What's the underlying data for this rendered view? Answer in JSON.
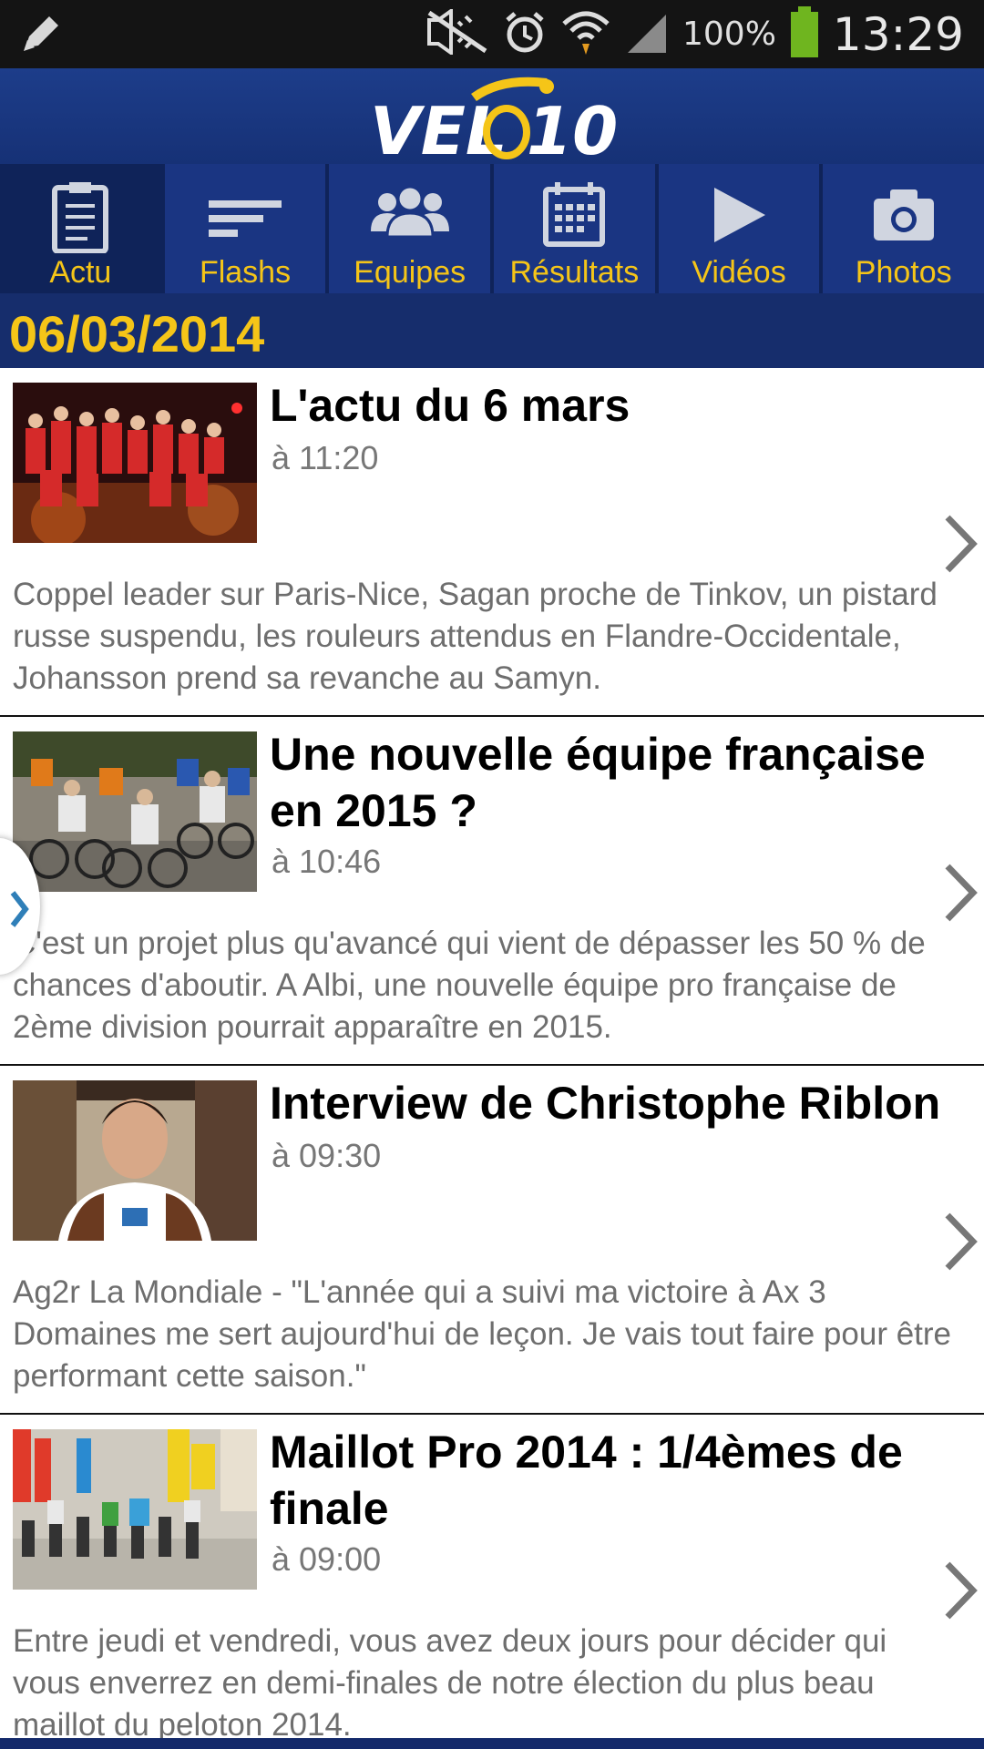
{
  "status_bar": {
    "battery_percent": "100%",
    "time": "13:29",
    "icons": [
      "edit-icon",
      "mute-icon",
      "alarm-icon",
      "wifi-icon",
      "signal-icon",
      "battery-icon"
    ]
  },
  "header": {
    "logo_text": "VELO101"
  },
  "nav": {
    "tabs": [
      {
        "label": "Actu",
        "icon": "clipboard-icon",
        "active": true
      },
      {
        "label": "Flashs",
        "icon": "lines-icon",
        "active": false
      },
      {
        "label": "Equipes",
        "icon": "team-icon",
        "active": false
      },
      {
        "label": "Résultats",
        "icon": "calendar-icon",
        "active": false
      },
      {
        "label": "Vidéos",
        "icon": "play-icon",
        "active": false
      },
      {
        "label": "Photos",
        "icon": "camera-icon",
        "active": false
      }
    ]
  },
  "date": "06/03/2014",
  "articles": [
    {
      "title": "L'actu du 6 mars",
      "time": "à 11:20",
      "description": "Coppel leader sur Paris-Nice, Sagan proche de Tinkov, un pistard russe suspendu, les rouleurs attendus en Flandre-Occidentale, Johansson prend sa revanche au Samyn."
    },
    {
      "title": "Une nouvelle équipe française en 2015 ?",
      "time": "à 10:46",
      "description": "C'est un projet plus qu'avancé qui vient de dépasser les 50 % de chances d'aboutir. A Albi, une nouvelle équipe pro française de 2ème division pourrait apparaître en 2015."
    },
    {
      "title": "Interview de Christophe Riblon",
      "time": "à 09:30",
      "description": "Ag2r La Mondiale - \"L'année qui a suivi ma victoire à Ax 3 Domaines me sert aujourd'hui de leçon. Je vais tout faire pour être performant cette saison.\""
    },
    {
      "title": "Maillot Pro 2014 : 1/4èmes de finale",
      "time": "à 09:00",
      "description": "Entre jeudi et vendredi, vous avez deux jours pour décider qui vous enverrez en demi-finales de notre élection du plus beau maillot du peloton 2014."
    }
  ],
  "colors": {
    "accent_yellow": "#f5c518",
    "nav_blue": "#1a3582",
    "header_blue": "#1d3d8a"
  }
}
